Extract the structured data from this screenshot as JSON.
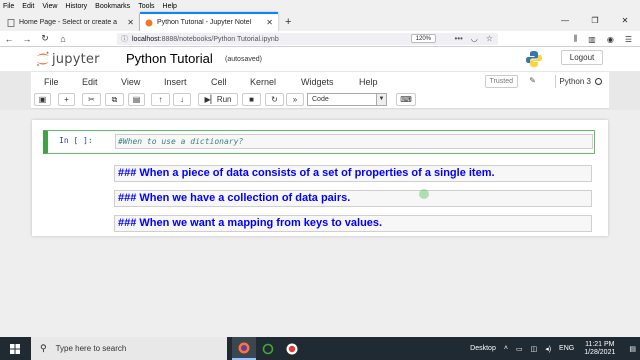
{
  "browser": {
    "menu": [
      "File",
      "Edit",
      "View",
      "History",
      "Bookmarks",
      "Tools",
      "Help"
    ],
    "tabs": [
      {
        "label": "Home Page - Select or create a",
        "active": false
      },
      {
        "label": "Python Tutorial - Jupyter Notel",
        "active": true
      }
    ],
    "url_host": "localhost",
    "url_rest": ":8888/notebooks/Python Tutorial.ipynb",
    "zoom": "120%"
  },
  "jupyter": {
    "logo_text": "jupyter",
    "notebook_title": "Python Tutorial",
    "autosave_status": "(autosaved)",
    "logout_label": "Logout",
    "menu": [
      "File",
      "Edit",
      "View",
      "Insert",
      "Cell",
      "Kernel",
      "Widgets",
      "Help"
    ],
    "trusted_label": "Trusted",
    "kernel_name": "Python 3",
    "run_label": "Run",
    "cell_type": "Code"
  },
  "cells": {
    "code_prompt": "In [ ]:",
    "code_text": "#When to use a dictionary?",
    "markdown": [
      "### When a piece of data consists of a set of properties of a single item.",
      "### When we have a collection of data pairs.",
      "### When we want a mapping from keys to values."
    ]
  },
  "taskbar": {
    "search_placeholder": "Type here to search",
    "tray_label": "Desktop",
    "language": "ENG",
    "time": "11:21 PM",
    "date": "1/28/2021"
  },
  "colors": {
    "markdown_text": "#0000ff",
    "cell_border": "#43a047",
    "taskbar_bg": "#1f2a33"
  }
}
